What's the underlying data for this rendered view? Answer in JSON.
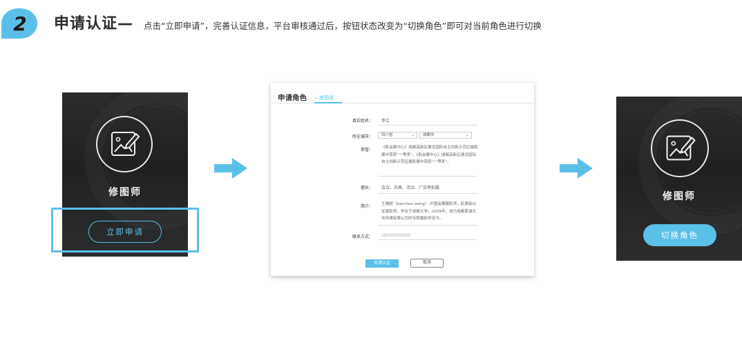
{
  "header": {
    "step_number": "2",
    "title": "申请认证—",
    "description": "点击“立即申请”，完善认证信息，平台审核通过后，按钮状态改变为“切换角色”即可对当前角色进行切换",
    "accent_color": "#5bc0e8"
  },
  "card_before": {
    "icon": "image-edit-icon",
    "role_name": "修图师",
    "button_label": "立即申请"
  },
  "card_after": {
    "icon": "image-edit-icon",
    "role_name": "修图师",
    "button_label": "切换角色"
  },
  "form": {
    "title": "申请角色",
    "subtitle": "—修图师",
    "fields": {
      "name_label": "真实姓名：",
      "name_value": "李立",
      "city_label": "所在城市：",
      "province_value": "四川省",
      "city_value": "成都市",
      "honor_label": "荣誉：",
      "honor_text": "《影会展中心》成都高新区建设国际自主创新示范区摄影展中荣获“一等奖”。《影会展中心》成都高新区建设国际自主创新示范区摄影展中荣获“一等奖”。",
      "skill_label": "擅长：",
      "skill_value": "会议、庆典、活动、广告等拍摄",
      "intro_label": "简介：",
      "intro_text": "王建超（jianchao wang）,中国会展摄影师，赶紧拍认证摄影师，毕业于成都大学，2009年，成为成都家诚文化传媒有限公司的专职摄影师至今。",
      "contact_label": "联系方式：",
      "contact_placeholder": "18000000000"
    },
    "submit_label": "申请认证",
    "cancel_label": "取消"
  }
}
